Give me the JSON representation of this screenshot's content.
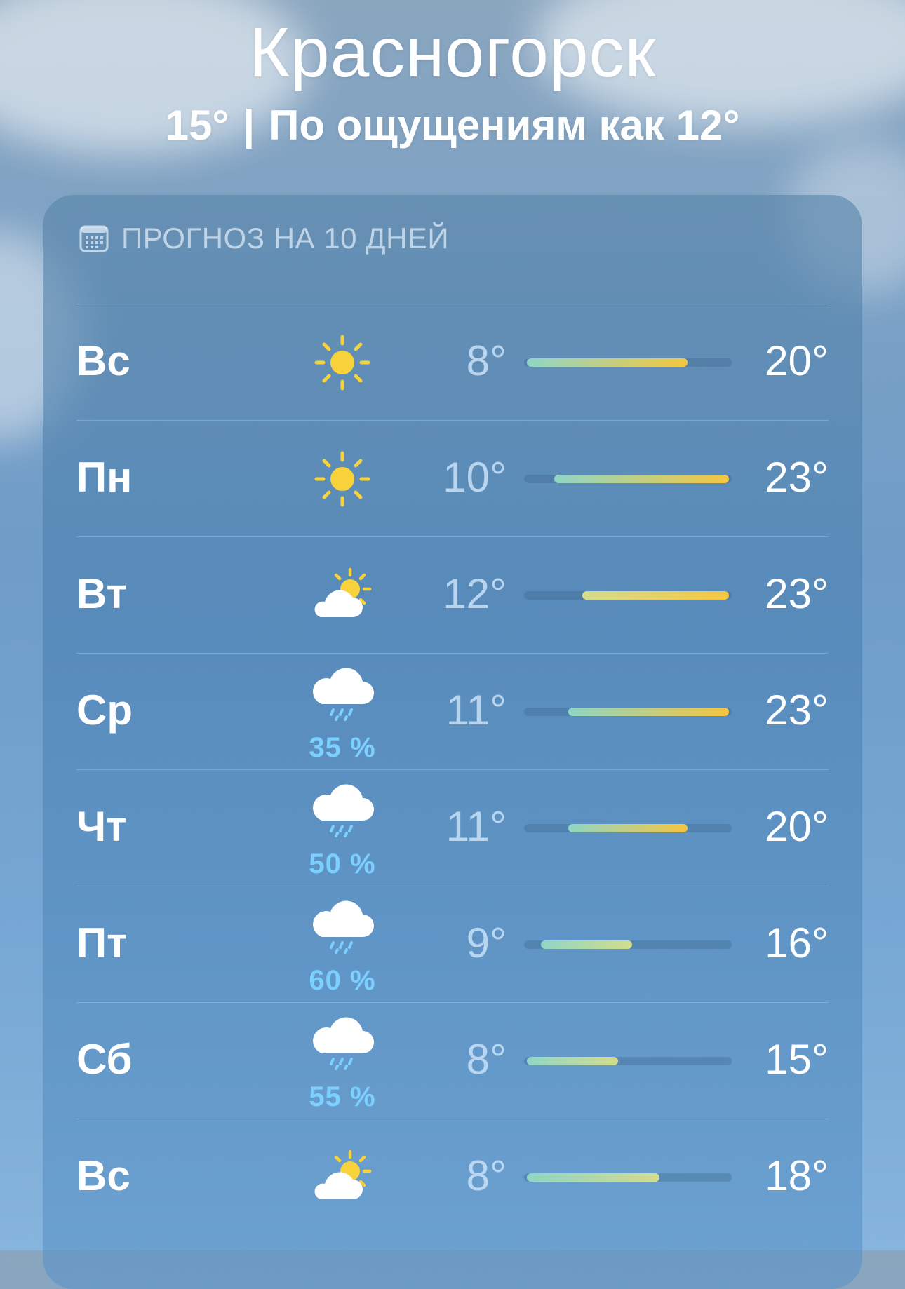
{
  "location": {
    "city": "Красногорск",
    "current_temp": "15°",
    "separator": "|",
    "feels_like": "По ощущениям как 12°"
  },
  "forecast": {
    "title": "ПРОГНОЗ НА 10 ДНЕЙ",
    "title_icon": "calendar-icon",
    "scale_min": 8,
    "scale_max": 23,
    "days": [
      {
        "day": "Вс",
        "icon": "sun-icon",
        "precip": "",
        "low": "8°",
        "high": "20°",
        "low_value": 8,
        "high_value": 20
      },
      {
        "day": "Пн",
        "icon": "sun-icon",
        "precip": "",
        "low": "10°",
        "high": "23°",
        "low_value": 10,
        "high_value": 23
      },
      {
        "day": "Вт",
        "icon": "partly-cloudy-icon",
        "precip": "",
        "low": "12°",
        "high": "23°",
        "low_value": 12,
        "high_value": 23
      },
      {
        "day": "Ср",
        "icon": "rain-cloud-icon",
        "precip": "35 %",
        "low": "11°",
        "high": "23°",
        "low_value": 11,
        "high_value": 23
      },
      {
        "day": "Чт",
        "icon": "rain-cloud-icon",
        "precip": "50 %",
        "low": "11°",
        "high": "20°",
        "low_value": 11,
        "high_value": 20
      },
      {
        "day": "Пт",
        "icon": "rain-cloud-icon",
        "precip": "60 %",
        "low": "9°",
        "high": "16°",
        "low_value": 9,
        "high_value": 16
      },
      {
        "day": "Сб",
        "icon": "rain-cloud-icon",
        "precip": "55 %",
        "low": "8°",
        "high": "15°",
        "low_value": 8,
        "high_value": 15
      },
      {
        "day": "Вс",
        "icon": "partly-cloudy-icon",
        "precip": "",
        "low": "8°",
        "high": "18°",
        "low_value": 8,
        "high_value": 18
      }
    ]
  },
  "colors": {
    "cool": "#8fd6c6",
    "mild": "#d4dc8c",
    "warm": "#f5c640",
    "sun": "#f7d23a",
    "precip_text": "#7cd0ff"
  }
}
